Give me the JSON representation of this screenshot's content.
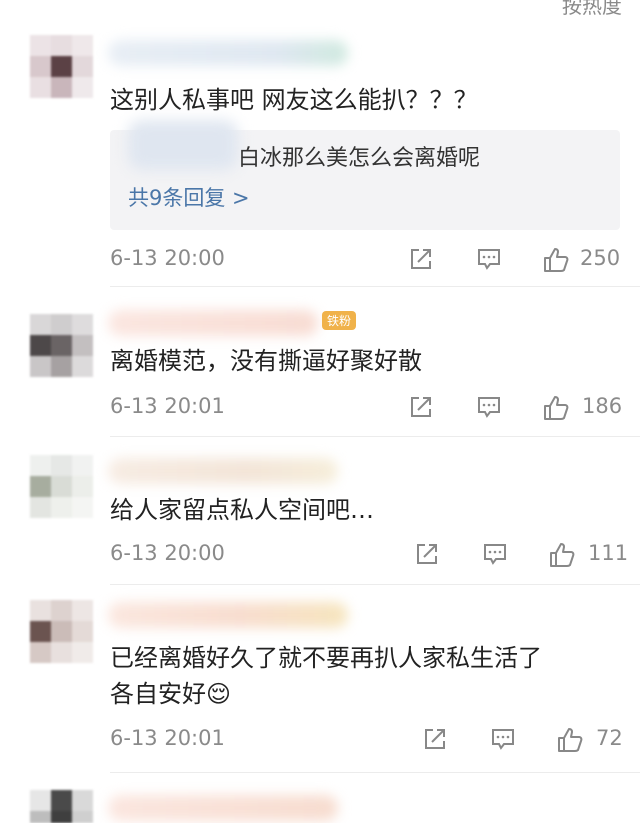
{
  "header": {
    "sort_label": "按热度"
  },
  "comments": [
    {
      "text": "这别人私事吧 网友这么能扒？？？",
      "reply": {
        "text": "白冰那么美怎么会离婚呢",
        "more": "共9条回复 >"
      },
      "time": "6-13 20:00",
      "likes": "250"
    },
    {
      "badge": "铁粉",
      "text": "离婚模范，没有撕逼好聚好散",
      "time": "6-13 20:01",
      "likes": "186"
    },
    {
      "text": "给人家留点私人空间吧…",
      "time": "6-13 20:00",
      "likes": "111"
    },
    {
      "text_line1": "已经离婚好久了就不要再扒人家私生活了",
      "text_line2": "各自安好",
      "emoji": "😌",
      "time": "6-13 20:01",
      "likes": "72"
    }
  ],
  "icons": [
    "share-icon",
    "comment-icon",
    "like-icon"
  ],
  "colors": {
    "link": "#4a76a8",
    "meta": "#8a8a8a",
    "reply_bg": "#f3f3f5"
  }
}
